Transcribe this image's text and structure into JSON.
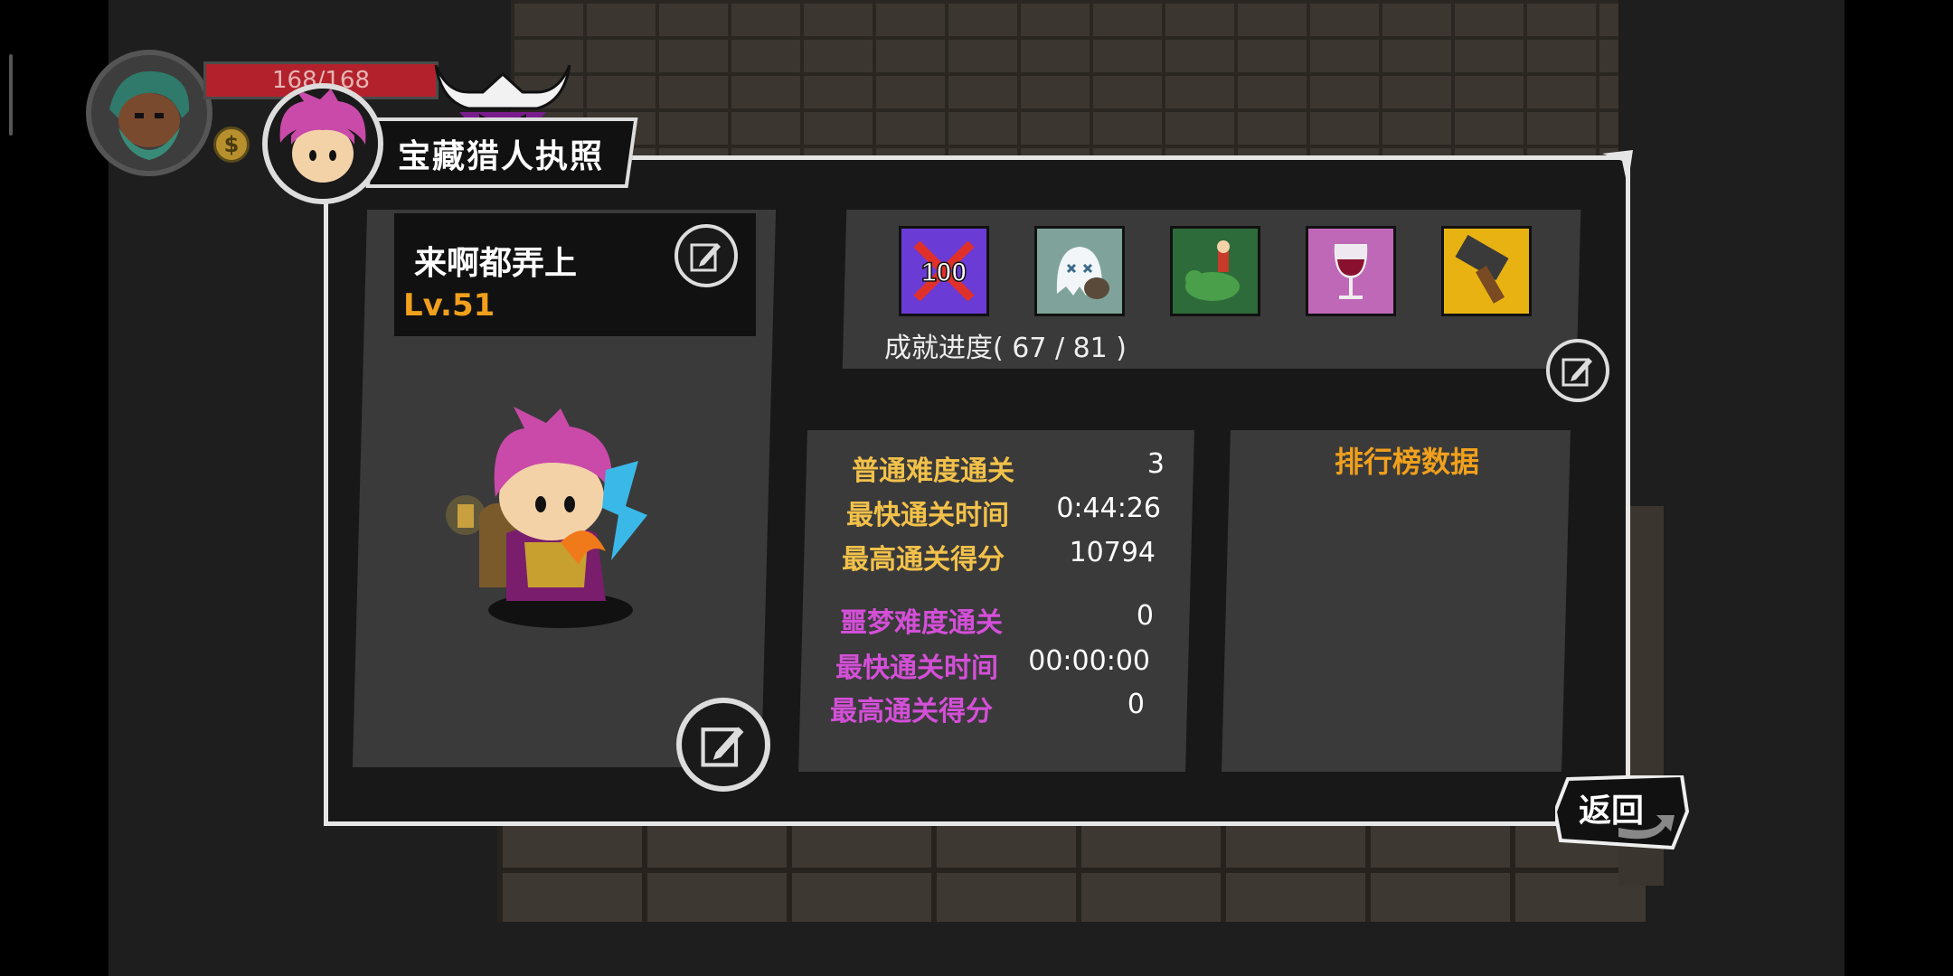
{
  "hud": {
    "hp_text": "168/168",
    "coin_symbol": "$"
  },
  "title": "宝藏猎人执照",
  "player": {
    "name": "来啊都弄上",
    "level": "Lv.51"
  },
  "achievements": {
    "icons": [
      "hundred-kills-achievement-icon",
      "ghost-achievement-icon",
      "dino-rider-achievement-icon",
      "wine-glass-achievement-icon",
      "hammer-achievement-icon"
    ],
    "badge_100": "100",
    "progress": "成就进度( 67 / 81 )"
  },
  "stats": {
    "normal": [
      {
        "label": "普通难度通关",
        "value": "3"
      },
      {
        "label": "最快通关时间",
        "value": "0:44:26"
      },
      {
        "label": "最高通关得分",
        "value": "10794"
      }
    ],
    "nightmare": [
      {
        "label": "噩梦难度通关",
        "value": "0"
      },
      {
        "label": "最快通关时间",
        "value": "00:00:00"
      },
      {
        "label": "最高通关得分",
        "value": "0"
      }
    ]
  },
  "leaderboard": {
    "title": "排行榜数据"
  },
  "back_button": "返回",
  "colors": {
    "panel_bg": "#181818",
    "card_bg": "#3a3a3a",
    "level_orange": "#f0a01c",
    "normal_gold": "#f2c14a",
    "nightmare_magenta": "#d44fd8",
    "hp_red": "#b3222c"
  }
}
